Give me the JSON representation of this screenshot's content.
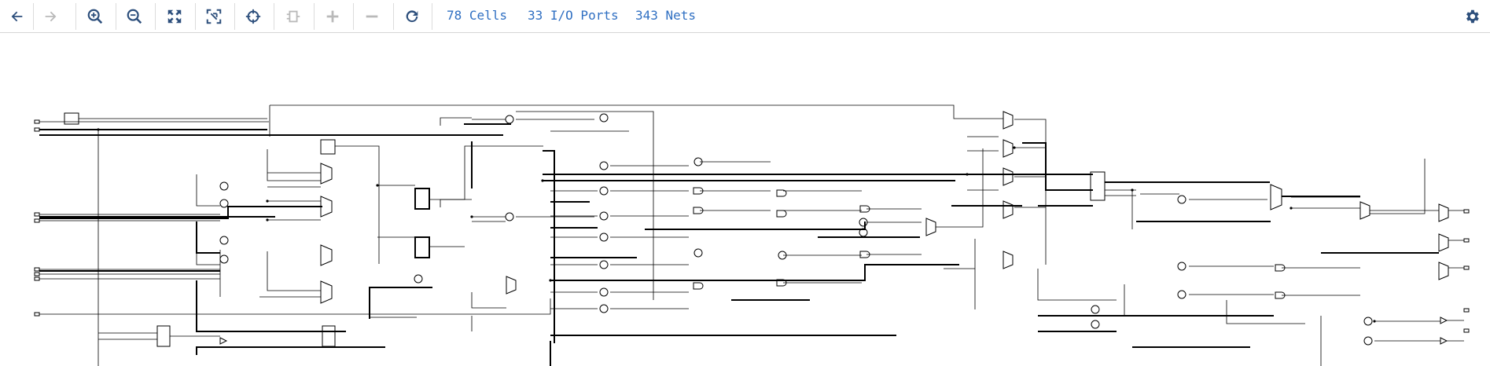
{
  "toolbar": {
    "buttons": [
      {
        "name": "back",
        "icon": "arrow-left-icon",
        "enabled": true
      },
      {
        "name": "forward",
        "icon": "arrow-right-icon",
        "enabled": false
      },
      {
        "name": "zoom-in",
        "icon": "zoom-in-icon",
        "enabled": true
      },
      {
        "name": "zoom-out",
        "icon": "zoom-out-icon",
        "enabled": true
      },
      {
        "name": "zoom-fit",
        "icon": "expand-icon",
        "enabled": true
      },
      {
        "name": "zoom-selection",
        "icon": "fit-selection-icon",
        "enabled": true
      },
      {
        "name": "locate",
        "icon": "crosshair-icon",
        "enabled": true
      },
      {
        "name": "collapse",
        "icon": "collapse-cell-icon",
        "enabled": false
      },
      {
        "name": "add",
        "icon": "plus-icon",
        "enabled": false
      },
      {
        "name": "remove",
        "icon": "minus-icon",
        "enabled": false
      },
      {
        "name": "refresh",
        "icon": "refresh-icon",
        "enabled": true
      }
    ],
    "stats": {
      "cells": "78 Cells",
      "ports": "33 I/O Ports",
      "nets": "343 Nets"
    },
    "settings_icon": "gear-icon"
  },
  "colors": {
    "accent": "#2f6fc2",
    "icon_active": "#2d4f7c",
    "icon_disabled": "#b9b9b9",
    "wire": "#000000"
  }
}
